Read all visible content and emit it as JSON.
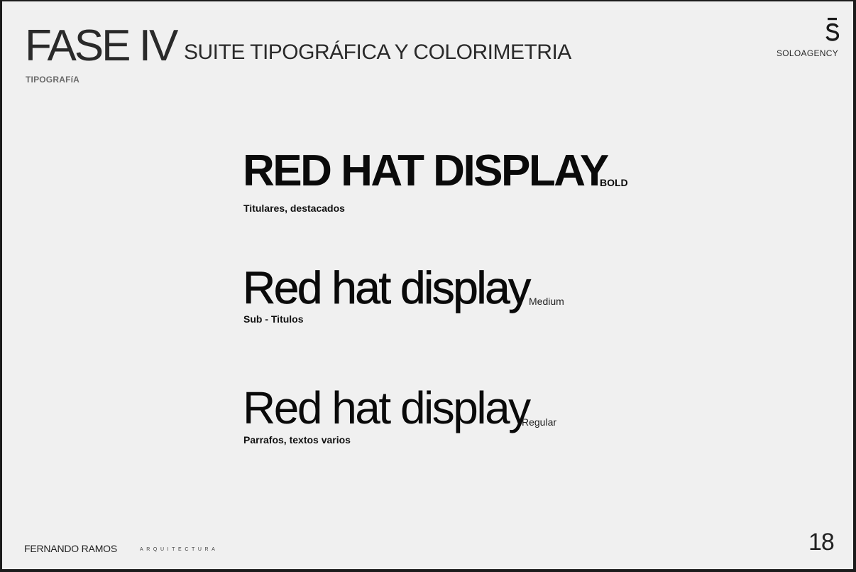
{
  "header": {
    "phase_title": "FASE IV",
    "phase_subtitle": "SUITE TIPOGRÁFICA Y COLORIMETRIA",
    "section_label": "TIPOGRAFíA"
  },
  "brand": {
    "logo_icon": "s-bar-logo-icon",
    "agency_name": "SOLOAGENCY"
  },
  "typography": {
    "samples": [
      {
        "sample_text": "RED HAT DISPLAY",
        "weight_label": "BOLD",
        "usage": "Titulares, destacados"
      },
      {
        "sample_text": "Red hat display",
        "weight_label": "Medium",
        "usage": "Sub - Titulos"
      },
      {
        "sample_text": "Red hat display",
        "weight_label": "Regular",
        "usage": "Parrafos, textos varios"
      }
    ]
  },
  "footer": {
    "author": "FERNANDO RAMOS",
    "discipline": "ARQUITECTURA",
    "page_number": "18"
  },
  "colors": {
    "background": "#f0f0f0",
    "frame": "#1b1b1b",
    "text": "#111111",
    "muted": "#6a6a6a"
  }
}
